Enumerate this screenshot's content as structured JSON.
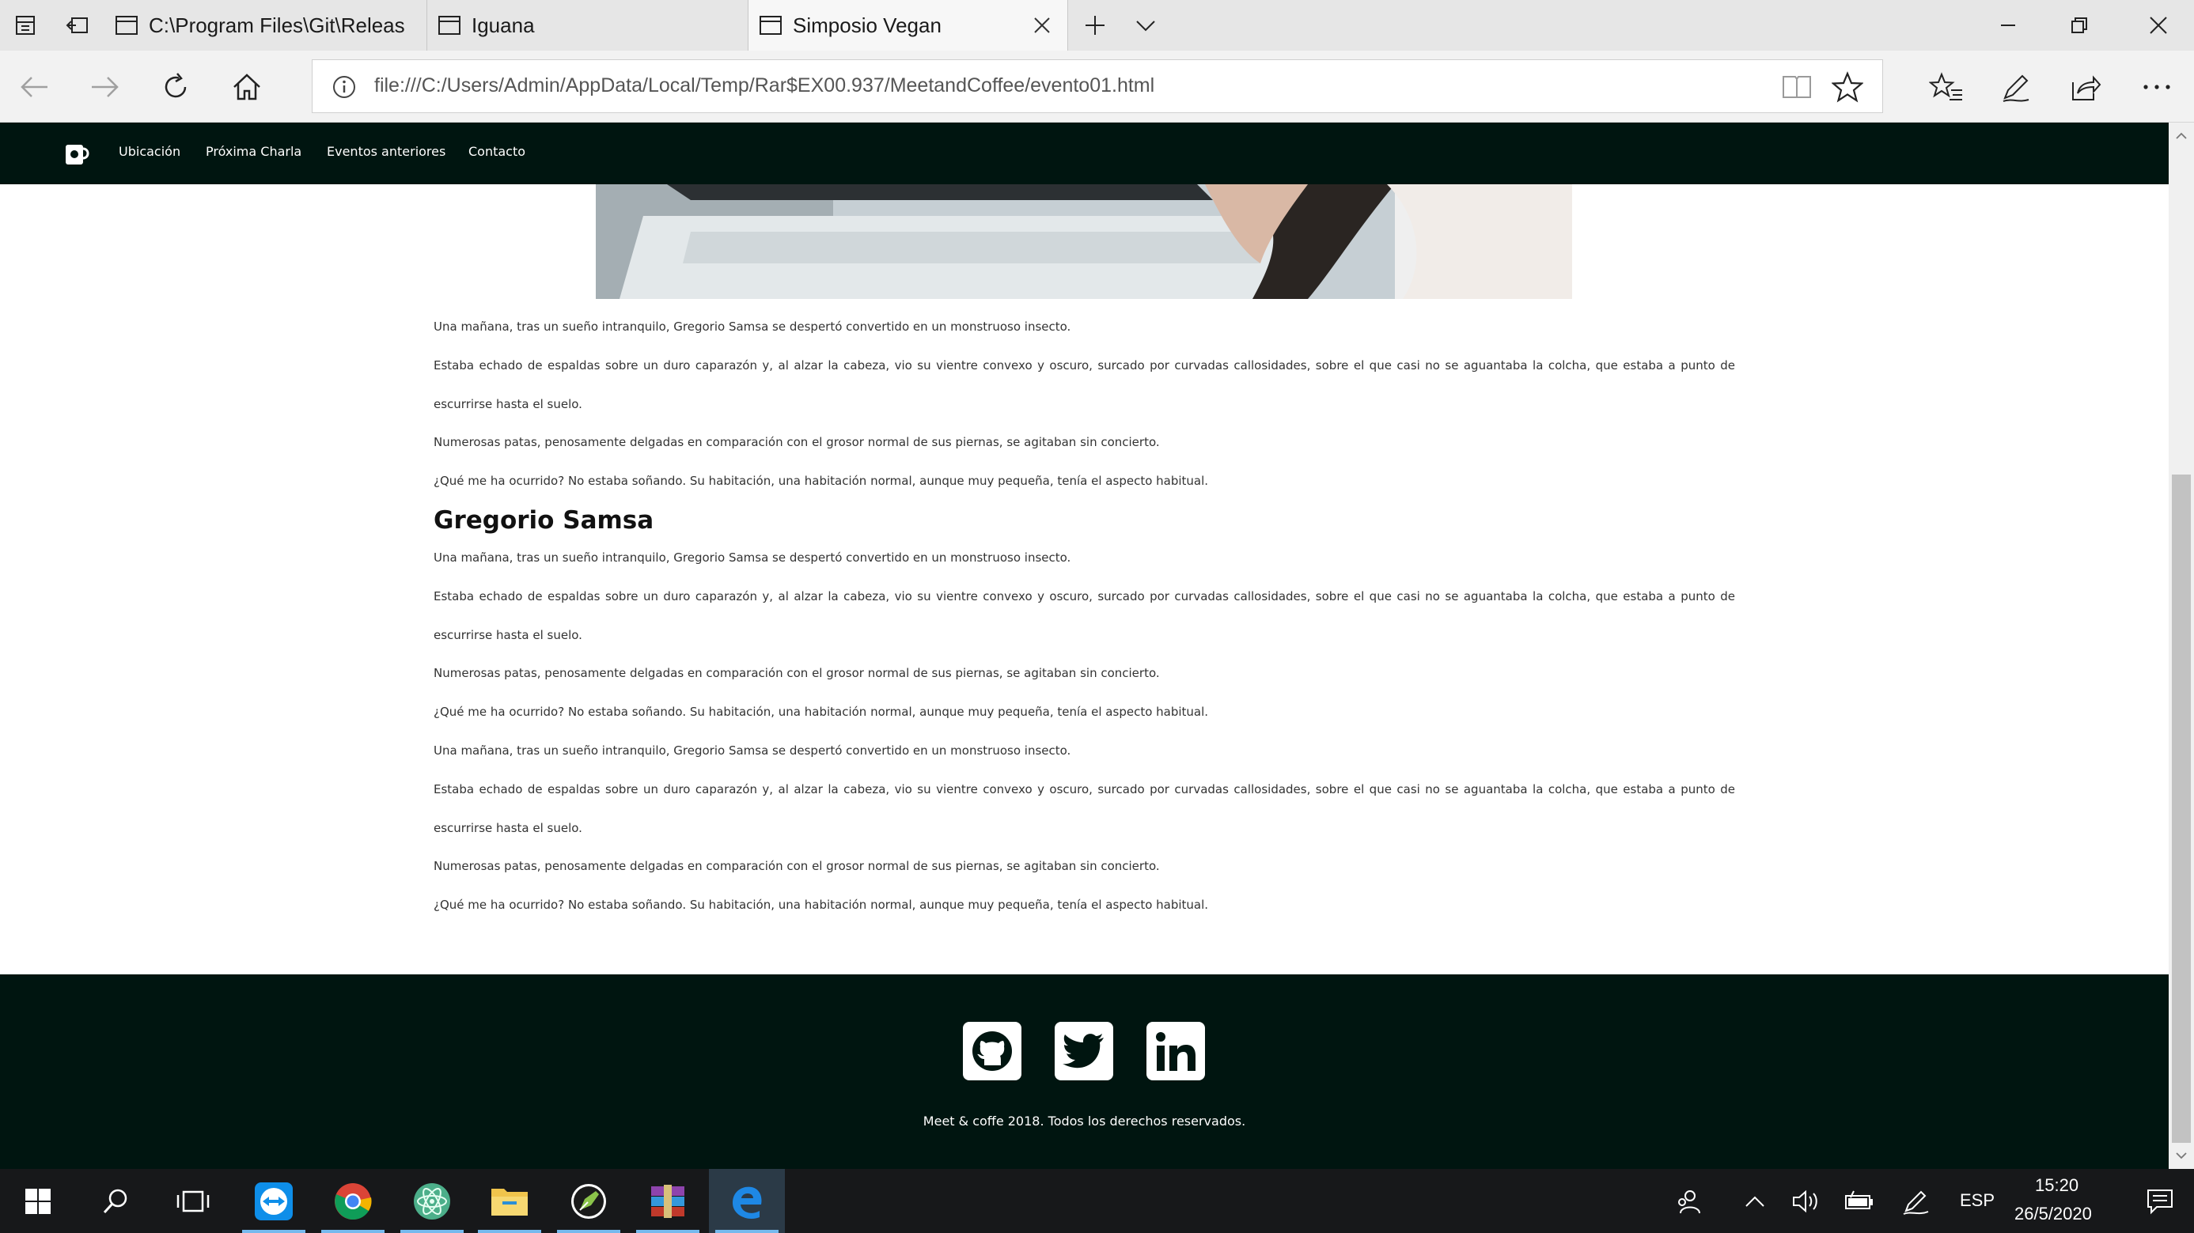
{
  "browser": {
    "tabs": [
      {
        "label": "C:\\Program Files\\Git\\Releas",
        "active": false
      },
      {
        "label": "Iguana",
        "active": false
      },
      {
        "label": "Simposio Vegan",
        "active": true
      }
    ],
    "url": "file:///C:/Users/Admin/AppData/Local/Temp/Rar$EX00.937/MeetandCoffee/evento01.html"
  },
  "site": {
    "nav": [
      "Ubicación",
      "Próxima Charla",
      "Eventos anteriores",
      "Contacto"
    ],
    "paragraphs_a": [
      "Una mañana, tras un sueño intranquilo, Gregorio Samsa se despertó convertido en un monstruoso insecto.",
      "Estaba echado de espaldas sobre un duro caparazón y, al alzar la cabeza, vio su vientre convexo y oscuro, surcado por curvadas callosidades, sobre el que casi no se aguantaba la colcha, que estaba a punto de escurrirse hasta el suelo.",
      "Numerosas patas, penosamente delgadas en comparación con el grosor normal de sus piernas, se agitaban sin concierto.",
      "¿Qué me ha ocurrido? No estaba soñando. Su habitación, una habitación normal, aunque muy pequeña, tenía el aspecto habitual."
    ],
    "heading": "Gregorio Samsa",
    "paragraphs_b": [
      "Una mañana, tras un sueño intranquilo, Gregorio Samsa se despertó convertido en un monstruoso insecto.",
      "Estaba echado de espaldas sobre un duro caparazón y, al alzar la cabeza, vio su vientre convexo y oscuro, surcado por curvadas callosidades, sobre el que casi no se aguantaba la colcha, que estaba a punto de escurrirse hasta el suelo.",
      "Numerosas patas, penosamente delgadas en comparación con el grosor normal de sus piernas, se agitaban sin concierto.",
      "¿Qué me ha ocurrido? No estaba soñando. Su habitación, una habitación normal, aunque muy pequeña, tenía el aspecto habitual.",
      "Una mañana, tras un sueño intranquilo, Gregorio Samsa se despertó convertido en un monstruoso insecto.",
      "Estaba echado de espaldas sobre un duro caparazón y, al alzar la cabeza, vio su vientre convexo y oscuro, surcado por curvadas callosidades, sobre el que casi no se aguantaba la colcha, que estaba a punto de escurrirse hasta el suelo.",
      "Numerosas patas, penosamente delgadas en comparación con el grosor normal de sus piernas, se agitaban sin concierto.",
      "¿Qué me ha ocurrido? No estaba soñando. Su habitación, una habitación normal, aunque muy pequeña, tenía el aspecto habitual."
    ],
    "footer": {
      "social": [
        "github-icon",
        "twitter-icon",
        "linkedin-icon"
      ],
      "copyright": "Meet & coffe 2018. Todos los derechos reservados."
    }
  },
  "taskbar": {
    "language": "ESP",
    "time": "15:20",
    "date": "26/5/2020"
  },
  "colors": {
    "site_dark": "#001510",
    "taskbar": "#17181a",
    "accent": "#76b9ed"
  }
}
